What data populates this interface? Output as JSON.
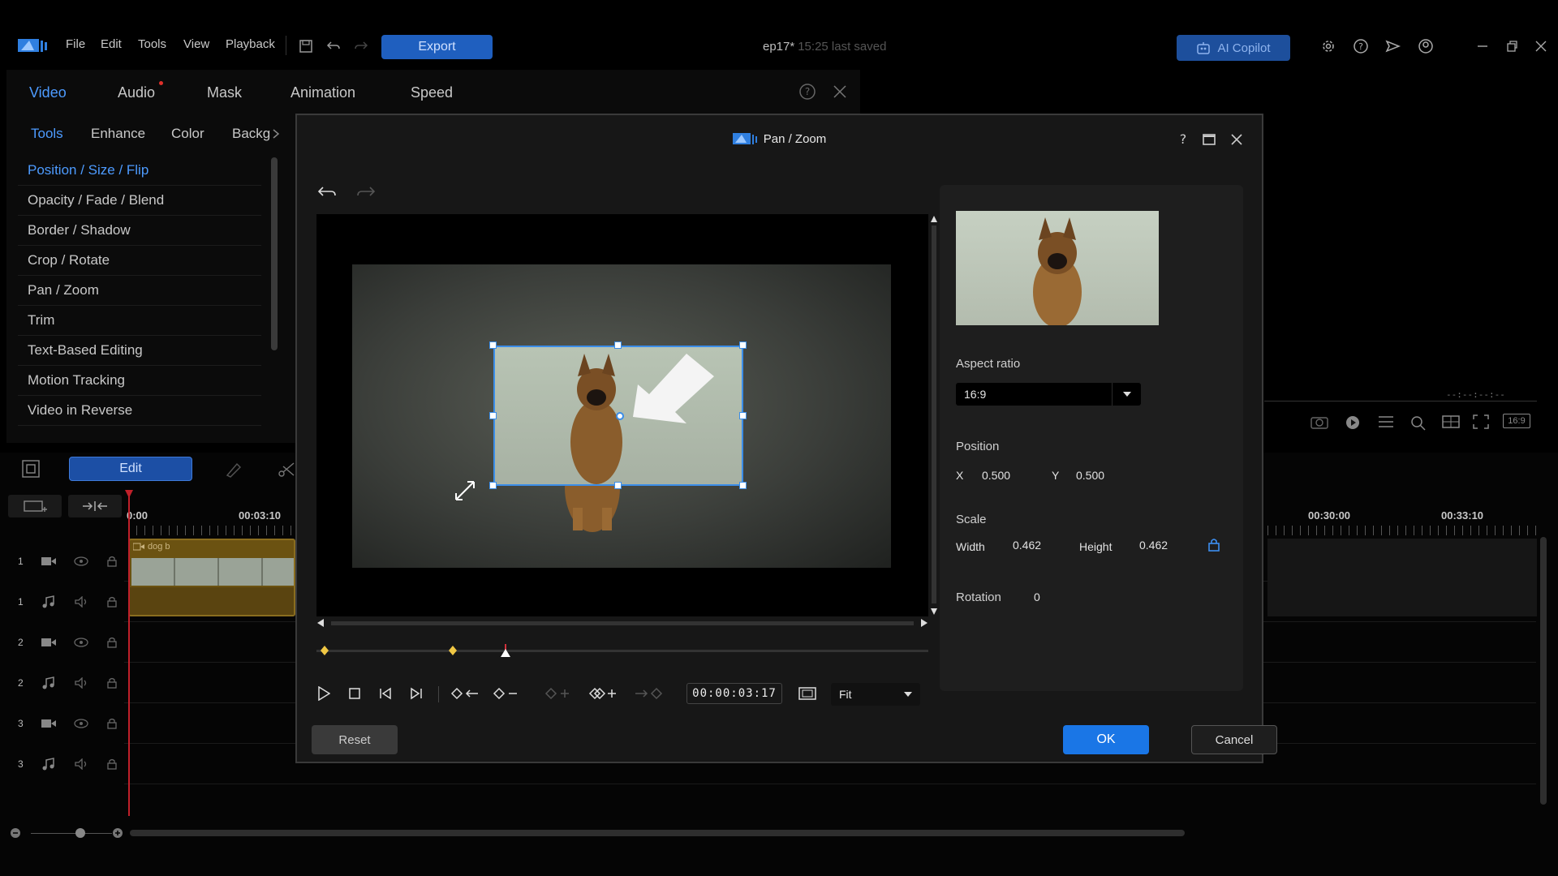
{
  "app": {
    "menu": [
      "File",
      "Edit",
      "Tools",
      "View",
      "Playback"
    ],
    "export_label": "Export",
    "project_name": "ep17*",
    "saved_text": "15:25 last saved",
    "ai_label": "AI Copilot"
  },
  "panel": {
    "main_tabs": [
      "Video",
      "Audio",
      "Mask",
      "Animation",
      "Speed"
    ],
    "sub_tabs": [
      "Tools",
      "Enhance",
      "Color",
      "Backg"
    ],
    "tools": [
      "Position / Size / Flip",
      "Opacity / Fade / Blend",
      "Border / Shadow",
      "Crop / Rotate",
      "Pan / Zoom",
      "Trim",
      "Text-Based Editing",
      "Motion Tracking",
      "Video in Reverse"
    ]
  },
  "timeline": {
    "edit_label": "Edit",
    "ruler": [
      "0:00",
      "00:03:10",
      "00:30:00",
      "00:33:10"
    ],
    "tracks": [
      "1",
      "1",
      "2",
      "2",
      "3",
      "3"
    ],
    "clip_name": "dog b",
    "preview_timecode": "--:--:--:--",
    "aspect_badge": "16:9"
  },
  "dialog": {
    "title": "Pan / Zoom",
    "aspect_label": "Aspect ratio",
    "aspect_value": "16:9",
    "position_label": "Position",
    "x_label": "X",
    "x_value": "0.500",
    "y_label": "Y",
    "y_value": "0.500",
    "scale_label": "Scale",
    "width_label": "Width",
    "width_value": "0.462",
    "height_label": "Height",
    "height_value": "0.462",
    "rotation_label": "Rotation",
    "rotation_value": "0",
    "timecode": "00:00:03:17",
    "fit_value": "Fit",
    "reset_label": "Reset",
    "ok_label": "OK",
    "cancel_label": "Cancel"
  },
  "colors": {
    "accent": "#1a76e6",
    "selection": "#3b8de8",
    "active_tab": "#4d9bff"
  }
}
